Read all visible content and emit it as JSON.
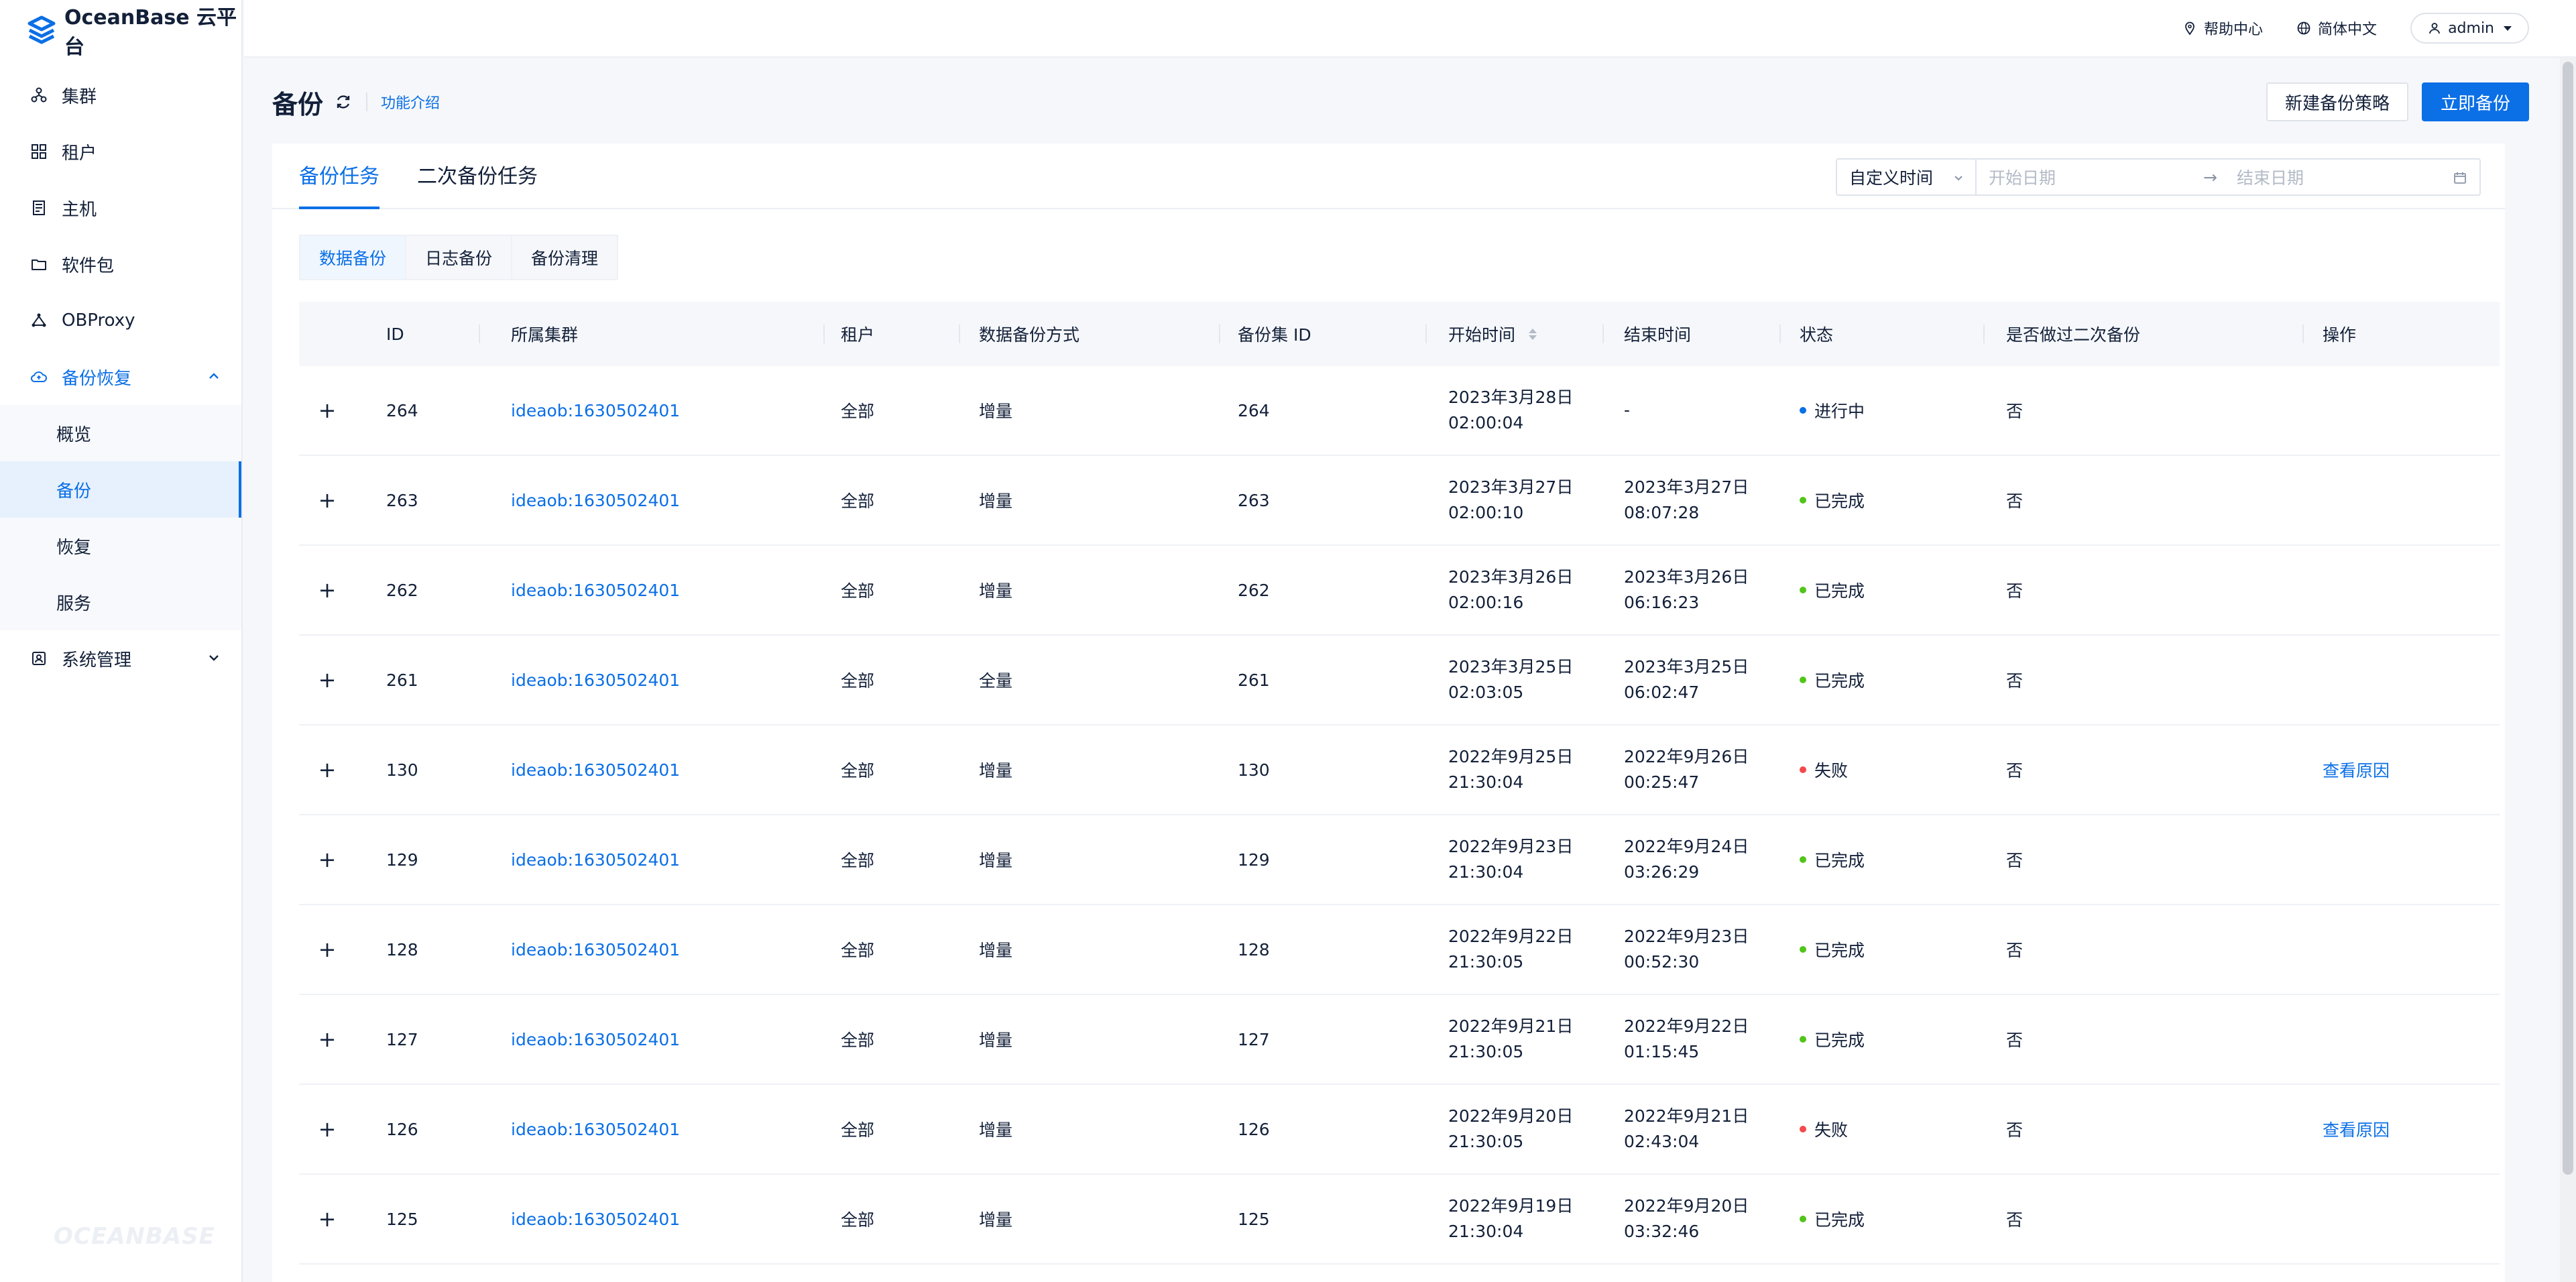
{
  "app": {
    "logo_text": "OceanBase 云平台",
    "watermark": "OCEANBASE"
  },
  "sidebar": {
    "items": [
      {
        "label": "集群",
        "icon": "cluster-icon"
      },
      {
        "label": "租户",
        "icon": "grid-icon"
      },
      {
        "label": "主机",
        "icon": "server-icon"
      },
      {
        "label": "软件包",
        "icon": "folder-icon"
      },
      {
        "label": "OBProxy",
        "icon": "network-icon"
      },
      {
        "label": "备份恢复",
        "icon": "cloud-icon"
      },
      {
        "label": "系统管理",
        "icon": "settings-icon"
      }
    ],
    "sub_items": [
      {
        "label": "概览"
      },
      {
        "label": "备份"
      },
      {
        "label": "恢复"
      },
      {
        "label": "服务"
      }
    ]
  },
  "topbar": {
    "help": "帮助中心",
    "language": "简体中文",
    "user": "admin"
  },
  "page": {
    "title": "备份",
    "intro_link": "功能介绍",
    "new_policy_button": "新建备份策略",
    "backup_now_button": "立即备份"
  },
  "tabs": [
    {
      "label": "备份任务"
    },
    {
      "label": "二次备份任务"
    }
  ],
  "filter": {
    "select_value": "自定义时间",
    "start_placeholder": "开始日期",
    "end_placeholder": "结束日期",
    "arrow": "→"
  },
  "subtabs": [
    {
      "label": "数据备份"
    },
    {
      "label": "日志备份"
    },
    {
      "label": "备份清理"
    }
  ],
  "table": {
    "columns": [
      "ID",
      "所属集群",
      "租户",
      "数据备份方式",
      "备份集 ID",
      "开始时间",
      "结束时间",
      "状态",
      "是否做过二次备份",
      "操作"
    ],
    "rows": [
      {
        "expand": "+",
        "id": "264",
        "cluster": "ideaob:1630502401",
        "tenant": "全部",
        "method": "增量",
        "set_id": "264",
        "start_date": "2023年3月28日",
        "start_time": "02:00:04",
        "end_date": "-",
        "end_time": "",
        "status": "进行中",
        "status_color": "#0b6fe6",
        "secondary": "否",
        "action": ""
      },
      {
        "expand": "+",
        "id": "263",
        "cluster": "ideaob:1630502401",
        "tenant": "全部",
        "method": "增量",
        "set_id": "263",
        "start_date": "2023年3月27日",
        "start_time": "02:00:10",
        "end_date": "2023年3月27日",
        "end_time": "08:07:28",
        "status": "已完成",
        "status_color": "#52c41a",
        "secondary": "否",
        "action": ""
      },
      {
        "expand": "+",
        "id": "262",
        "cluster": "ideaob:1630502401",
        "tenant": "全部",
        "method": "增量",
        "set_id": "262",
        "start_date": "2023年3月26日",
        "start_time": "02:00:16",
        "end_date": "2023年3月26日",
        "end_time": "06:16:23",
        "status": "已完成",
        "status_color": "#52c41a",
        "secondary": "否",
        "action": ""
      },
      {
        "expand": "+",
        "id": "261",
        "cluster": "ideaob:1630502401",
        "tenant": "全部",
        "method": "全量",
        "set_id": "261",
        "start_date": "2023年3月25日",
        "start_time": "02:03:05",
        "end_date": "2023年3月25日",
        "end_time": "06:02:47",
        "status": "已完成",
        "status_color": "#52c41a",
        "secondary": "否",
        "action": ""
      },
      {
        "expand": "+",
        "id": "130",
        "cluster": "ideaob:1630502401",
        "tenant": "全部",
        "method": "增量",
        "set_id": "130",
        "start_date": "2022年9月25日",
        "start_time": "21:30:04",
        "end_date": "2022年9月26日",
        "end_time": "00:25:47",
        "status": "失败",
        "status_color": "#f5484a",
        "secondary": "否",
        "action": "查看原因"
      },
      {
        "expand": "+",
        "id": "129",
        "cluster": "ideaob:1630502401",
        "tenant": "全部",
        "method": "增量",
        "set_id": "129",
        "start_date": "2022年9月23日",
        "start_time": "21:30:04",
        "end_date": "2022年9月24日",
        "end_time": "03:26:29",
        "status": "已完成",
        "status_color": "#52c41a",
        "secondary": "否",
        "action": ""
      },
      {
        "expand": "+",
        "id": "128",
        "cluster": "ideaob:1630502401",
        "tenant": "全部",
        "method": "增量",
        "set_id": "128",
        "start_date": "2022年9月22日",
        "start_time": "21:30:05",
        "end_date": "2022年9月23日",
        "end_time": "00:52:30",
        "status": "已完成",
        "status_color": "#52c41a",
        "secondary": "否",
        "action": ""
      },
      {
        "expand": "+",
        "id": "127",
        "cluster": "ideaob:1630502401",
        "tenant": "全部",
        "method": "增量",
        "set_id": "127",
        "start_date": "2022年9月21日",
        "start_time": "21:30:05",
        "end_date": "2022年9月22日",
        "end_time": "01:15:45",
        "status": "已完成",
        "status_color": "#52c41a",
        "secondary": "否",
        "action": ""
      },
      {
        "expand": "+",
        "id": "126",
        "cluster": "ideaob:1630502401",
        "tenant": "全部",
        "method": "增量",
        "set_id": "126",
        "start_date": "2022年9月20日",
        "start_time": "21:30:05",
        "end_date": "2022年9月21日",
        "end_time": "02:43:04",
        "status": "失败",
        "status_color": "#f5484a",
        "secondary": "否",
        "action": "查看原因"
      },
      {
        "expand": "+",
        "id": "125",
        "cluster": "ideaob:1630502401",
        "tenant": "全部",
        "method": "增量",
        "set_id": "125",
        "start_date": "2022年9月19日",
        "start_time": "21:30:04",
        "end_date": "2022年9月20日",
        "end_time": "03:32:46",
        "status": "已完成",
        "status_color": "#52c41a",
        "secondary": "否",
        "action": ""
      }
    ]
  }
}
